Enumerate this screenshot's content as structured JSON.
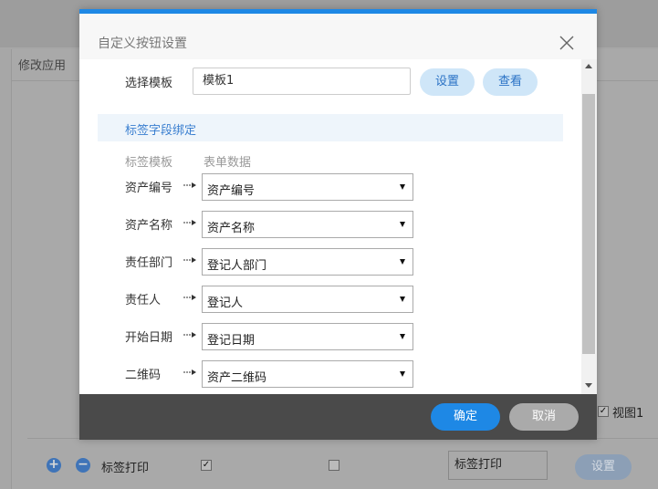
{
  "background": {
    "tab_label": "修改应用",
    "view_checkbox_label": "视图1",
    "row": {
      "add_icon": "plus-circle-icon",
      "remove_icon": "minus-circle-icon",
      "label": "标签打印",
      "checkbox1_checked": true,
      "checkbox2_checked": false,
      "input_value": "标签打印",
      "settings_button": "设置"
    }
  },
  "dialog": {
    "title": "自定义按钮设置",
    "close_icon": "close-icon",
    "template": {
      "label": "选择模板",
      "value": "模板1",
      "settings_button": "设置",
      "view_button": "查看"
    },
    "binding_section": {
      "title": "标签字段绑定",
      "col_template": "标签模板",
      "col_form": "表单数据",
      "rows": [
        {
          "label": "资产编号",
          "value": "资产编号"
        },
        {
          "label": "资产名称",
          "value": "资产名称"
        },
        {
          "label": "责任部门",
          "value": "登记人部门"
        },
        {
          "label": "责任人",
          "value": "登记人"
        },
        {
          "label": "开始日期",
          "value": "登记日期"
        },
        {
          "label": "二维码",
          "value": "资产二维码"
        }
      ]
    },
    "footer": {
      "ok_button": "确定",
      "cancel_button": "取消"
    },
    "colors": {
      "accent": "#1e88e5",
      "pill_bg": "#cfe6f8",
      "footer_bg": "#4a4a4a"
    }
  }
}
